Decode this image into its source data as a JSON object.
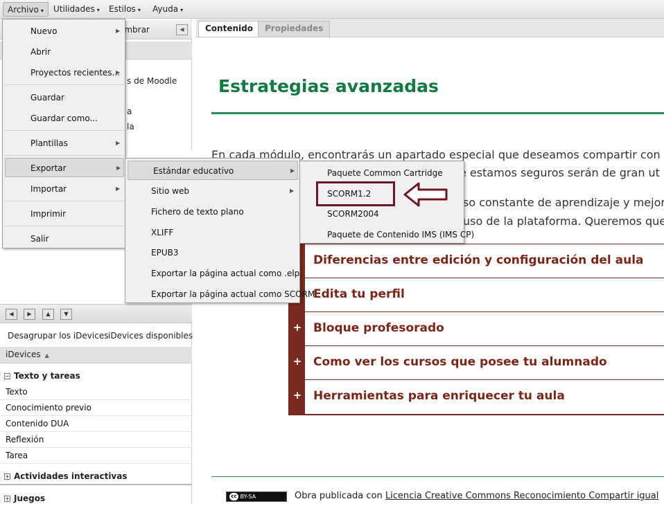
{
  "menubar": {
    "items": [
      {
        "label": "Archivo",
        "accel": "A",
        "rest": "rchivo"
      },
      {
        "label": "Utilidades",
        "accel": "U",
        "rest": "tilidades"
      },
      {
        "label": "Estilos",
        "accel": "E",
        "rest": "stilos"
      },
      {
        "label": "Ayuda",
        "accel": "",
        "rest": "Ayuda"
      }
    ]
  },
  "left_panel": {
    "rename_label": "ombrar",
    "tree_fragments": [
      "s de Moodle",
      "a",
      "la"
    ]
  },
  "idevices": {
    "tab_ungroup": "Desagrupar los iDevices",
    "tab_available": "iDevices disponibles",
    "heading": "iDevices",
    "categories": [
      {
        "label": "Texto y tareas",
        "expanded": true
      },
      {
        "label": "Actividades interactivas",
        "expanded": false
      },
      {
        "label": "Juegos",
        "expanded": false
      }
    ],
    "items": [
      "Texto",
      "Conocimiento previo",
      "Contenido DUA",
      "Reflexión",
      "Tarea"
    ]
  },
  "tabs": [
    {
      "label": "Contenido",
      "selected": true
    },
    {
      "label": "Propiedades",
      "selected": false
    }
  ],
  "content": {
    "title": "Estrategias avanzadas",
    "paragraph_lines": [
      "En cada módulo, encontrarás un apartado especial que deseamos compartir con",
      "e estamos seguros serán de gran ut",
      "so constante de aprendizaje y mejor",
      "uso de la plataforma. Queremos que"
    ],
    "accordion": [
      {
        "label": "Diferencias entre edición y configuración del aula",
        "plus": ""
      },
      {
        "label": "Edita tu perfil",
        "plus": ""
      },
      {
        "label": "Bloque profesorado",
        "plus": "+"
      },
      {
        "label": "Como ver los cursos que posee tu alumnado",
        "plus": "+"
      },
      {
        "label": "Herramientas para enriquecer tu aula",
        "plus": "+"
      }
    ],
    "license_badge": "BY-SA",
    "license_prefix": "Obra publicada con ",
    "license_link": "Licencia Creative Commons Reconocimiento Compartir igual"
  },
  "menu_archivo": {
    "items": [
      {
        "label": "Nuevo",
        "submenu": true
      },
      {
        "label": "Abrir",
        "submenu": false
      },
      {
        "label": "Proyectos recientes...",
        "submenu": true
      },
      {
        "label": "Guardar",
        "submenu": false
      },
      {
        "label": "Guardar como...",
        "submenu": false
      },
      {
        "label": "Plantillas",
        "submenu": true
      },
      {
        "label": "Exportar",
        "submenu": true,
        "highlighted": true
      },
      {
        "label": "Importar",
        "submenu": true
      },
      {
        "label": "Imprimir",
        "submenu": false
      },
      {
        "label": "Salir",
        "submenu": false
      }
    ]
  },
  "menu_exportar": {
    "items": [
      {
        "label": "Estándar educativo",
        "submenu": true,
        "highlighted": true
      },
      {
        "label": "Sitio web",
        "submenu": true
      },
      {
        "label": "Fichero de texto plano",
        "submenu": false
      },
      {
        "label": "XLIFF",
        "submenu": false
      },
      {
        "label": "EPUB3",
        "submenu": false
      },
      {
        "label": "Exportar la página actual como .elp.",
        "submenu": false
      },
      {
        "label": "Exportar la página actual como SCORM",
        "submenu": false
      }
    ]
  },
  "menu_estandar": {
    "items": [
      {
        "label": "Paquete Common Cartridge"
      },
      {
        "label": "SCORM1.2",
        "annotated": true
      },
      {
        "label": "SCORM2004"
      },
      {
        "label": "Paquete de Contenido IMS (IMS CP)"
      }
    ]
  },
  "colors": {
    "title_green": "#117a45",
    "accordion_brown": "#7b2517",
    "annotation_maroon": "#6f1424"
  },
  "icons": [
    "chevron-down-icon",
    "chevron-right-icon",
    "arrow-left-icon",
    "arrow-right-icon",
    "arrow-up-icon",
    "arrow-down-icon",
    "collapse-left-icon",
    "expand-box-icon",
    "collapse-box-icon",
    "plus-icon",
    "creative-commons-icon",
    "pointer-arrow-icon"
  ]
}
